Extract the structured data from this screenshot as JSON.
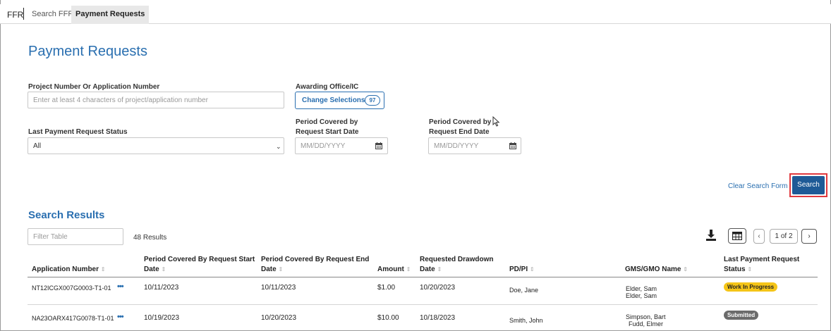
{
  "nav": {
    "brand": "FFR",
    "tabs": [
      "Search FFR",
      "Payment Requests"
    ]
  },
  "page": {
    "title": "Payment Requests"
  },
  "form": {
    "project_label": "Project Number Or Application Number",
    "project_placeholder": "Enter at least 4 characters of project/application number",
    "office_label": "Awarding Office/IC",
    "change_btn": "Change Selections",
    "change_count": "97",
    "status_label": "Last Payment Request Status",
    "status_value": "All",
    "start_label_1": "Period Covered by",
    "start_label_2": "Request Start Date",
    "end_label_1": "Period Covered by",
    "end_label_2": "Request End Date",
    "date_placeholder": "MM/DD/YYYY",
    "clear": "Clear Search Form",
    "search": "Search"
  },
  "results": {
    "title": "Search Results",
    "filter_placeholder": "Filter Table",
    "count": "48 Results",
    "page": "1 of 2",
    "prev": "‹",
    "next": "›"
  },
  "table": {
    "headers": {
      "app": "Application Number",
      "start_1": "Period Covered By Request Start",
      "start_2": "Date",
      "end_1": "Period Covered By Request End",
      "end_2": "Date",
      "amount": "Amount",
      "drawdown_1": "Requested Drawdown",
      "drawdown_2": "Date",
      "pdpi": "PD/PI",
      "gms": "GMS/GMO Name",
      "status_1": "Last Payment Request",
      "status_2": "Status"
    },
    "rows": [
      {
        "app": "NT12ICGX007G0003-T1-01",
        "dots": "•••",
        "start": "10/11/2023",
        "end": "10/11/2023",
        "amount": "$1.00",
        "drawdown": "10/20/2023",
        "pdpi": "Doe, Jane",
        "gms1": "Elder, Sam",
        "gms2": "Elder, Sam",
        "status": "Work In Progress"
      },
      {
        "app": "NA23OARX417G0078-T1-01",
        "dots": "•••",
        "start": "10/19/2023",
        "end": "10/20/2023",
        "amount": "$10.00",
        "drawdown": "10/18/2023",
        "pdpi": "Smith, John",
        "gms1": "Simpson, Bart",
        "gms2": "Fudd, Elmer",
        "status": "Submitted"
      }
    ]
  },
  "colors": {
    "accent": "#2a6fb0",
    "button": "#1e5a96",
    "highlight": "#e0393e",
    "wip": "#f5c518",
    "submitted": "#6b6b6b"
  }
}
